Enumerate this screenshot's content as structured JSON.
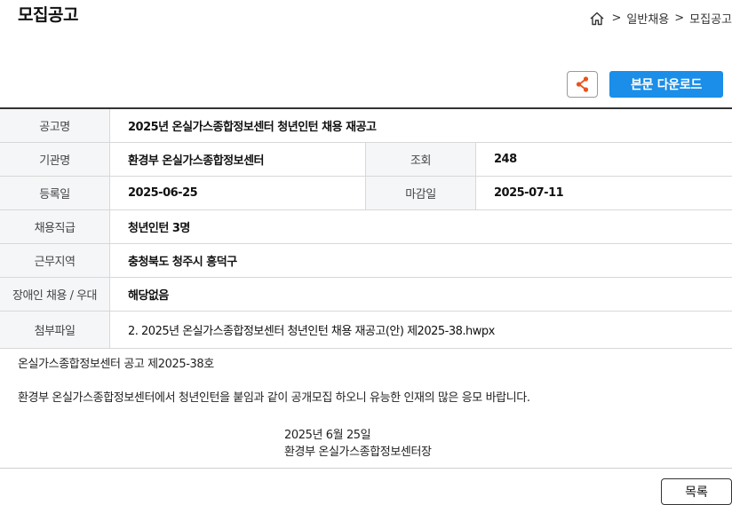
{
  "page": {
    "title": "모집공고"
  },
  "breadcrumb": {
    "home_icon": "home-icon",
    "separator": ">",
    "items": [
      "일반채용",
      "모집공고"
    ]
  },
  "toolbar": {
    "share_icon": "share-icon",
    "download_label": "본문 다운로드"
  },
  "info": {
    "title_label": "공고명",
    "title_value": "2025년 온실가스종합정보센터 청년인턴 채용 재공고",
    "org_label": "기관명",
    "org_value": "환경부 온실가스종합정보센터",
    "views_label": "조회",
    "views_value": "248",
    "reg_label": "등록일",
    "reg_value": "2025-06-25",
    "deadline_label": "마감일",
    "deadline_value": "2025-07-11",
    "rank_label": "채용직급",
    "rank_value": "청년인턴 3명",
    "location_label": "근무지역",
    "location_value": "충청북도 청주시 흥덕구",
    "disabled_label": "장애인 채용 / 우대",
    "disabled_value": "해당없음",
    "attach_label": "첨부파일",
    "attach_value": "2. 2025년 온실가스종합정보센터 청년인턴 채용 재공고(안) 제2025-38.hwpx"
  },
  "body": {
    "notice_number": "온실가스종합정보센터 공고 제2025-38호",
    "message": "환경부 온실가스종합정보센터에서 청년인턴을 붙임과 같이 공개모집 하오니 유능한 인재의 많은 응모 바랍니다.",
    "date": "2025년 6월 25일",
    "signer": "환경부 온실가스종합정보센터장"
  },
  "footer": {
    "list_label": "목록"
  },
  "colors": {
    "accent": "#1a8ee8",
    "share_icon": "#e8531c",
    "header_bg": "#f4f6f8"
  }
}
